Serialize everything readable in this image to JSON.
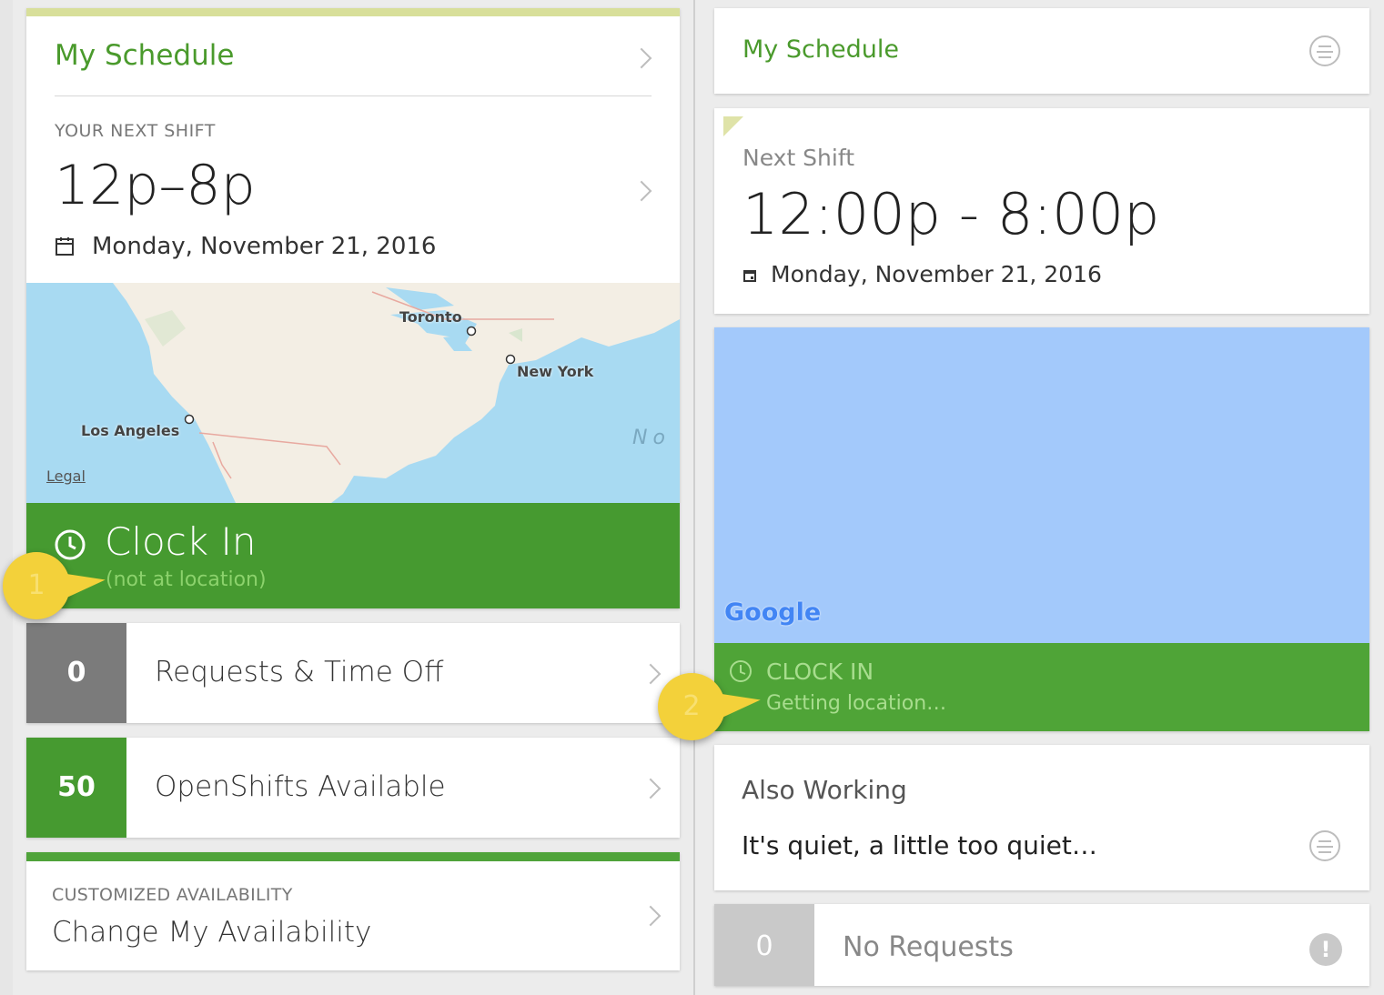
{
  "left": {
    "schedule_title": "My Schedule",
    "next_shift_label": "YOUR NEXT SHIFT",
    "shift_time": "12p–8p",
    "shift_date": "Monday, November 21, 2016",
    "map": {
      "cities": [
        "Toronto",
        "New York",
        "Los Angeles"
      ],
      "ocean_label": "No",
      "legal_link": "Legal"
    },
    "clock_in_label": "Clock In",
    "clock_in_status": "(not at location)",
    "requests": {
      "count": "0",
      "label": "Requests & Time Off"
    },
    "openshifts": {
      "count": "50",
      "label": "OpenShifts Available"
    },
    "availability": {
      "caption": "CUSTOMIZED AVAILABILITY",
      "label": "Change My Availability"
    }
  },
  "right": {
    "schedule_title": "My Schedule",
    "next_shift_label": "Next Shift",
    "shift_time": "12:00p - 8:00p",
    "shift_date": "Monday, November 21, 2016",
    "map_logo": "Google",
    "clock_in_label": "CLOCK IN",
    "clock_in_status": "Getting location…",
    "also_working_title": "Also Working",
    "also_working_text": "It's quiet, a little too quiet…",
    "requests": {
      "count": "0",
      "label": "No Requests"
    }
  },
  "callouts": [
    "1",
    "2"
  ],
  "colors": {
    "brand_green": "#4a9a2c",
    "clock_green_left": "#469a30",
    "clock_green_right": "#4fa437",
    "map_blue": "#a3c9fb",
    "gray_badge": "#7b7b7b",
    "callout_yellow": "#f3d13a"
  }
}
